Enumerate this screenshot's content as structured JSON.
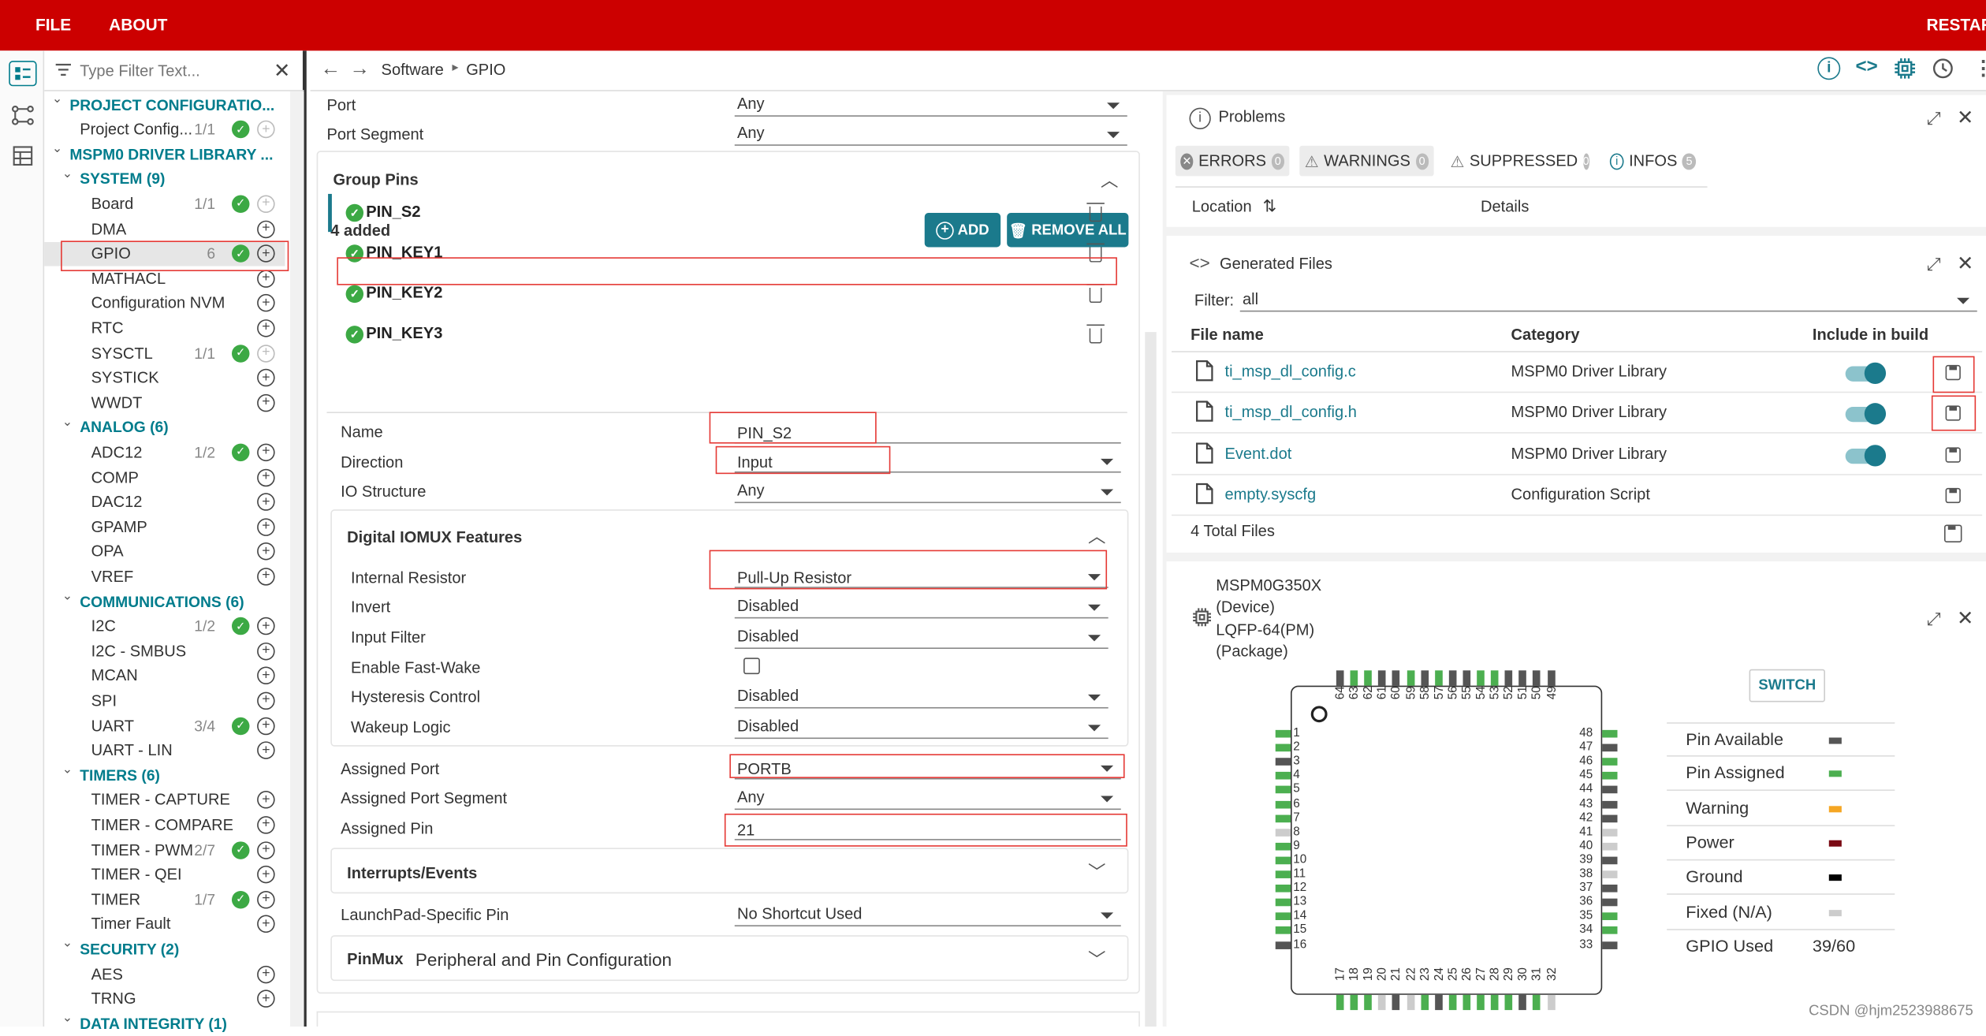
{
  "menu": {
    "file": "FILE",
    "about": "ABOUT",
    "restart": "RESTAR"
  },
  "filter": {
    "placeholder": "Type Filter Text..."
  },
  "tree": [
    {
      "label": "PROJECT CONFIGURATIO...",
      "type": "section"
    },
    {
      "label": "Project Config...",
      "count": "1/1",
      "check": true,
      "plus_disabled": true
    },
    {
      "label": "MSPM0 DRIVER LIBRARY ...",
      "type": "section"
    },
    {
      "label": "SYSTEM (9)",
      "type": "sub"
    },
    {
      "label": "Board",
      "count": "1/1",
      "check": true,
      "plus_disabled": true
    },
    {
      "label": "DMA"
    },
    {
      "label": "GPIO",
      "count": "6",
      "check": true,
      "selected": true
    },
    {
      "label": "MATHACL"
    },
    {
      "label": "Configuration NVM"
    },
    {
      "label": "RTC"
    },
    {
      "label": "SYSCTL",
      "count": "1/1",
      "check": true,
      "plus_disabled": true
    },
    {
      "label": "SYSTICK"
    },
    {
      "label": "WWDT"
    },
    {
      "label": "ANALOG (6)",
      "type": "sub"
    },
    {
      "label": "ADC12",
      "count": "1/2",
      "check": true
    },
    {
      "label": "COMP"
    },
    {
      "label": "DAC12"
    },
    {
      "label": "GPAMP"
    },
    {
      "label": "OPA"
    },
    {
      "label": "VREF"
    },
    {
      "label": "COMMUNICATIONS (6)",
      "type": "sub"
    },
    {
      "label": "I2C",
      "count": "1/2",
      "check": true
    },
    {
      "label": "I2C - SMBUS"
    },
    {
      "label": "MCAN"
    },
    {
      "label": "SPI"
    },
    {
      "label": "UART",
      "count": "3/4",
      "check": true
    },
    {
      "label": "UART - LIN"
    },
    {
      "label": "TIMERS (6)",
      "type": "sub"
    },
    {
      "label": "TIMER - CAPTURE"
    },
    {
      "label": "TIMER - COMPARE"
    },
    {
      "label": "TIMER - PWM",
      "count": "2/7",
      "check": true
    },
    {
      "label": "TIMER - QEI"
    },
    {
      "label": "TIMER",
      "count": "1/7",
      "check": true
    },
    {
      "label": "Timer Fault"
    },
    {
      "label": "SECURITY (2)",
      "type": "sub"
    },
    {
      "label": "AES"
    },
    {
      "label": "TRNG"
    },
    {
      "label": "DATA INTEGRITY (1)",
      "type": "sub"
    }
  ],
  "breadcrumb": {
    "root": "Software",
    "leaf": "GPIO"
  },
  "gpio": {
    "port_label": "Port",
    "port_value": "Any",
    "port_segment_label": "Port Segment",
    "port_segment_value": "Any",
    "group_pins_title": "Group Pins",
    "added": "4 added",
    "add_btn": "ADD",
    "remove_all_btn": "REMOVE ALL",
    "pins": [
      "PIN_S2",
      "PIN_KEY1",
      "PIN_KEY2",
      "PIN_KEY3"
    ],
    "name_label": "Name",
    "name_value": "PIN_S2",
    "direction_label": "Direction",
    "direction_value": "Input",
    "io_structure_label": "IO Structure",
    "io_structure_value": "Any",
    "iomux_title": "Digital IOMUX Features",
    "internal_resistor_label": "Internal Resistor",
    "internal_resistor_value": "Pull-Up Resistor",
    "invert_label": "Invert",
    "invert_value": "Disabled",
    "input_filter_label": "Input Filter",
    "input_filter_value": "Disabled",
    "fast_wake_label": "Enable Fast-Wake",
    "hysteresis_label": "Hysteresis Control",
    "hysteresis_value": "Disabled",
    "wakeup_label": "Wakeup Logic",
    "wakeup_value": "Disabled",
    "assigned_port_label": "Assigned Port",
    "assigned_port_value": "PORTB",
    "assigned_port_segment_label": "Assigned Port Segment",
    "assigned_port_segment_value": "Any",
    "assigned_pin_label": "Assigned Pin",
    "assigned_pin_value": "21",
    "interrupts_title": "Interrupts/Events",
    "launchpad_label": "LaunchPad-Specific Pin",
    "launchpad_value": "No Shortcut Used",
    "pinmux_title": "PinMux",
    "pinmux_subtitle": "Peripheral and Pin Configuration"
  },
  "problems": {
    "title": "Problems",
    "errors": "ERRORS",
    "errors_count": "0",
    "warnings": "WARNINGS",
    "warnings_count": "0",
    "suppressed": "SUPPRESSED",
    "suppressed_count": "0",
    "infos": "INFOS",
    "infos_count": "5",
    "col_location": "Location",
    "col_details": "Details"
  },
  "generated": {
    "title": "Generated Files",
    "filter_label": "Filter:",
    "filter_value": "all",
    "col_file": "File name",
    "col_category": "Category",
    "col_build": "Include in build",
    "files": [
      {
        "name": "ti_msp_dl_config.c",
        "category": "MSPM0 Driver Library",
        "toggle": true
      },
      {
        "name": "ti_msp_dl_config.h",
        "category": "MSPM0 Driver Library",
        "toggle": true
      },
      {
        "name": "Event.dot",
        "category": "MSPM0 Driver Library",
        "toggle": true
      },
      {
        "name": "empty.syscfg",
        "category": "Configuration Script",
        "toggle": false
      }
    ],
    "total": "4 Total Files"
  },
  "device": {
    "line1": "MSPM0G350X",
    "line2": "(Device)",
    "line3": "LQFP-64(PM)",
    "line4": "(Package)",
    "switch_btn": "SWITCH",
    "legend": [
      {
        "label": "Pin Available",
        "color": "#555555"
      },
      {
        "label": "Pin Assigned",
        "color": "#4caf50"
      },
      {
        "label": "Warning",
        "color": "#f5a623"
      },
      {
        "label": "Power",
        "color": "#7a0a14"
      },
      {
        "label": "Ground",
        "color": "#000000"
      },
      {
        "label": "Fixed (N/A)",
        "color": "#cccccc"
      }
    ],
    "gpio_used_label": "GPIO Used",
    "gpio_used_value": "39/60"
  },
  "watermark": "CSDN @hjm2523988675",
  "colors": {
    "topbar": "#cc0000",
    "accent": "#1b7a8c",
    "check": "#3ca944",
    "highlight": "#e53935"
  }
}
